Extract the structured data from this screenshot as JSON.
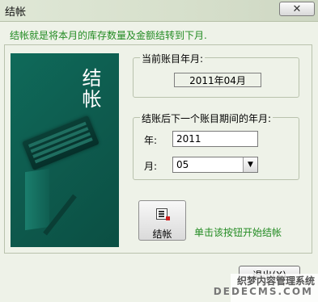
{
  "window": {
    "title": "结帐",
    "close_label": "✕"
  },
  "info": {
    "text": "结帐就是将本月的库存数量及金额结转到下月."
  },
  "picture": {
    "title": "结帐"
  },
  "current_period": {
    "legend": "当前账目年月:",
    "value": "2011年04月"
  },
  "next_period": {
    "legend": "结账后下一个账目期间的年月:",
    "year_label": "年:",
    "year_value": "2011",
    "month_label": "月:",
    "month_value": "05",
    "month_arrow": "▼"
  },
  "actions": {
    "close_book_label": "结帐",
    "hint": "单击该按钮开始结帐",
    "exit_label": "退出(X)"
  },
  "watermark": {
    "line1": "织梦内容管理系统",
    "line2": "DEDECMS.COM"
  }
}
